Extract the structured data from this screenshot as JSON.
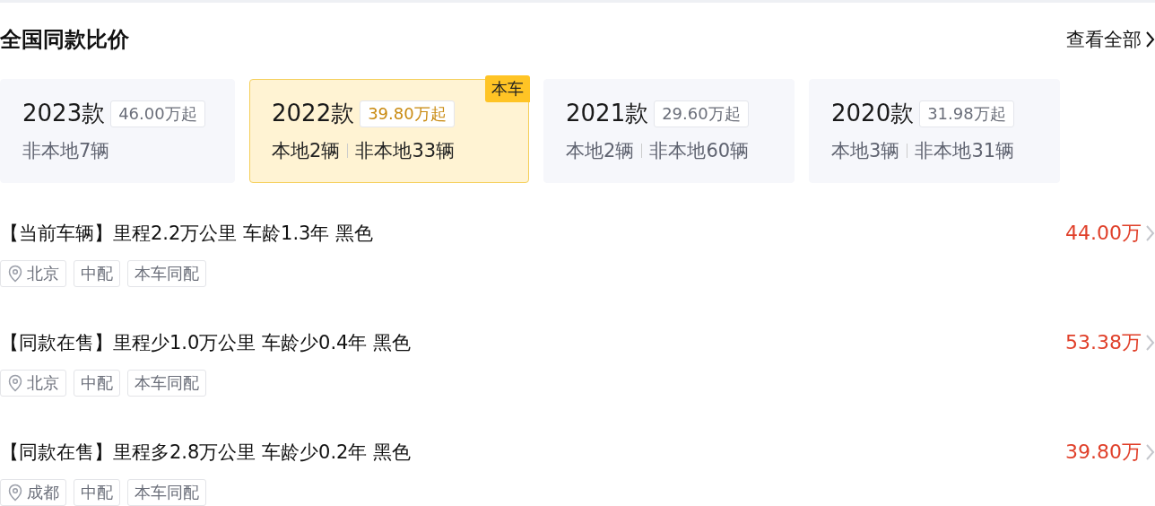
{
  "header": {
    "title": "全国同款比价",
    "link": "查看全部"
  },
  "models": [
    {
      "year": "2023款",
      "price": "46.00万起",
      "counts": [
        "非本地7辆"
      ],
      "selected": false
    },
    {
      "year": "2022款",
      "price": "39.80万起",
      "counts": [
        "本地2辆",
        "非本地33辆"
      ],
      "selected": true,
      "badge": "本车"
    },
    {
      "year": "2021款",
      "price": "29.60万起",
      "counts": [
        "本地2辆",
        "非本地60辆"
      ],
      "selected": false
    },
    {
      "year": "2020款",
      "price": "31.98万起",
      "counts": [
        "本地3辆",
        "非本地31辆"
      ],
      "selected": false
    }
  ],
  "listings": [
    {
      "title": "【当前车辆】里程2.2万公里 车龄1.3年 黑色",
      "price": "44.00万",
      "tags": [
        {
          "kind": "location",
          "text": "北京"
        },
        {
          "kind": "plain",
          "text": "中配"
        },
        {
          "kind": "plain",
          "text": "本车同配"
        }
      ]
    },
    {
      "title": "【同款在售】里程少1.0万公里 车龄少0.4年 黑色",
      "price": "53.38万",
      "tags": [
        {
          "kind": "location",
          "text": "北京"
        },
        {
          "kind": "plain",
          "text": "中配"
        },
        {
          "kind": "plain",
          "text": "本车同配"
        }
      ]
    },
    {
      "title": "【同款在售】里程多2.8万公里 车龄少0.2年 黑色",
      "price": "39.80万",
      "tags": [
        {
          "kind": "location",
          "text": "成都"
        },
        {
          "kind": "plain",
          "text": "中配"
        },
        {
          "kind": "plain",
          "text": "本车同配"
        }
      ]
    }
  ]
}
